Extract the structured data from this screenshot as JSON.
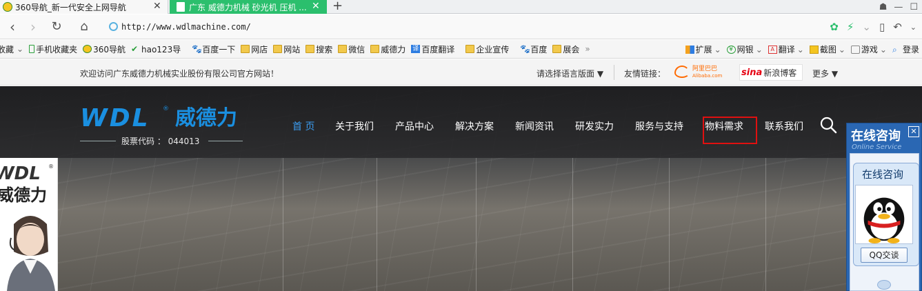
{
  "browser": {
    "tabs": [
      {
        "title": "360导航_新一代安全上网导航",
        "close": "✕"
      },
      {
        "title": "广东 威德力机械 砂光机 压机 ...",
        "close": "✕"
      }
    ],
    "new_tab": "+",
    "url": "http://www.wdlmachine.com/",
    "bookmarks_left": [
      {
        "label": "收藏",
        "icon": "star-icon",
        "arrow": "⌄"
      },
      {
        "label": "手机收藏夹",
        "icon": "phone-icon"
      },
      {
        "label": "360导航",
        "icon": "360-icon"
      },
      {
        "label": "hao123导",
        "icon": "hao123-icon"
      },
      {
        "label": "百度一下",
        "icon": "baidu-icon"
      },
      {
        "label": "网店",
        "icon": "folder-icon"
      },
      {
        "label": "网站",
        "icon": "folder-icon"
      },
      {
        "label": "搜索",
        "icon": "folder-icon"
      },
      {
        "label": "微信",
        "icon": "folder-icon"
      },
      {
        "label": "威德力",
        "icon": "folder-icon"
      },
      {
        "label": "百度翻译",
        "icon": "translate-icon"
      },
      {
        "label": "企业宣传",
        "icon": "folder-icon"
      },
      {
        "label": "百度",
        "icon": "baidu-icon"
      },
      {
        "label": "展会",
        "icon": "folder-icon"
      }
    ],
    "bookmarks_more": "»",
    "bookmarks_right": [
      {
        "label": "扩展",
        "arrow": "⌄"
      },
      {
        "label": "网银",
        "arrow": "⌄"
      },
      {
        "label": "翻译",
        "arrow": "⌄"
      },
      {
        "label": "截图",
        "arrow": "⌄"
      },
      {
        "label": "游戏",
        "arrow": "⌄"
      },
      {
        "label": "登录",
        "arrow": ""
      }
    ]
  },
  "site": {
    "welcome": "欢迎访问广东威德力机械实业股份有限公司官方网站！",
    "language": "请选择语言版面 ▼",
    "friend_links": "友情链接：",
    "alibaba_cn": "阿里巴巴",
    "alibaba_en": "Alibaba.com",
    "sina_logo": "sina",
    "sina_text": "新浪博客",
    "more": "更多 ▼",
    "logo_en": "WDL",
    "logo_reg": "®",
    "logo_cn": "威德力",
    "stock": "股票代码 ： 044013",
    "nav": [
      {
        "label": "首 页"
      },
      {
        "label": "关于我们"
      },
      {
        "label": "产品中心"
      },
      {
        "label": "解决方案"
      },
      {
        "label": "新闻资讯"
      },
      {
        "label": "研发实力"
      },
      {
        "label": "服务与支持"
      },
      {
        "label": "物料需求"
      },
      {
        "label": "联系我们"
      }
    ],
    "left_panel": {
      "logo_en": "WDL",
      "logo_reg": "®",
      "logo_cn": "威德力"
    },
    "consult": {
      "title": "在线咨询",
      "subtitle": "Online Service",
      "close": "✕",
      "inner_title": "在线咨询",
      "qq_button": "QQ交谈"
    }
  }
}
